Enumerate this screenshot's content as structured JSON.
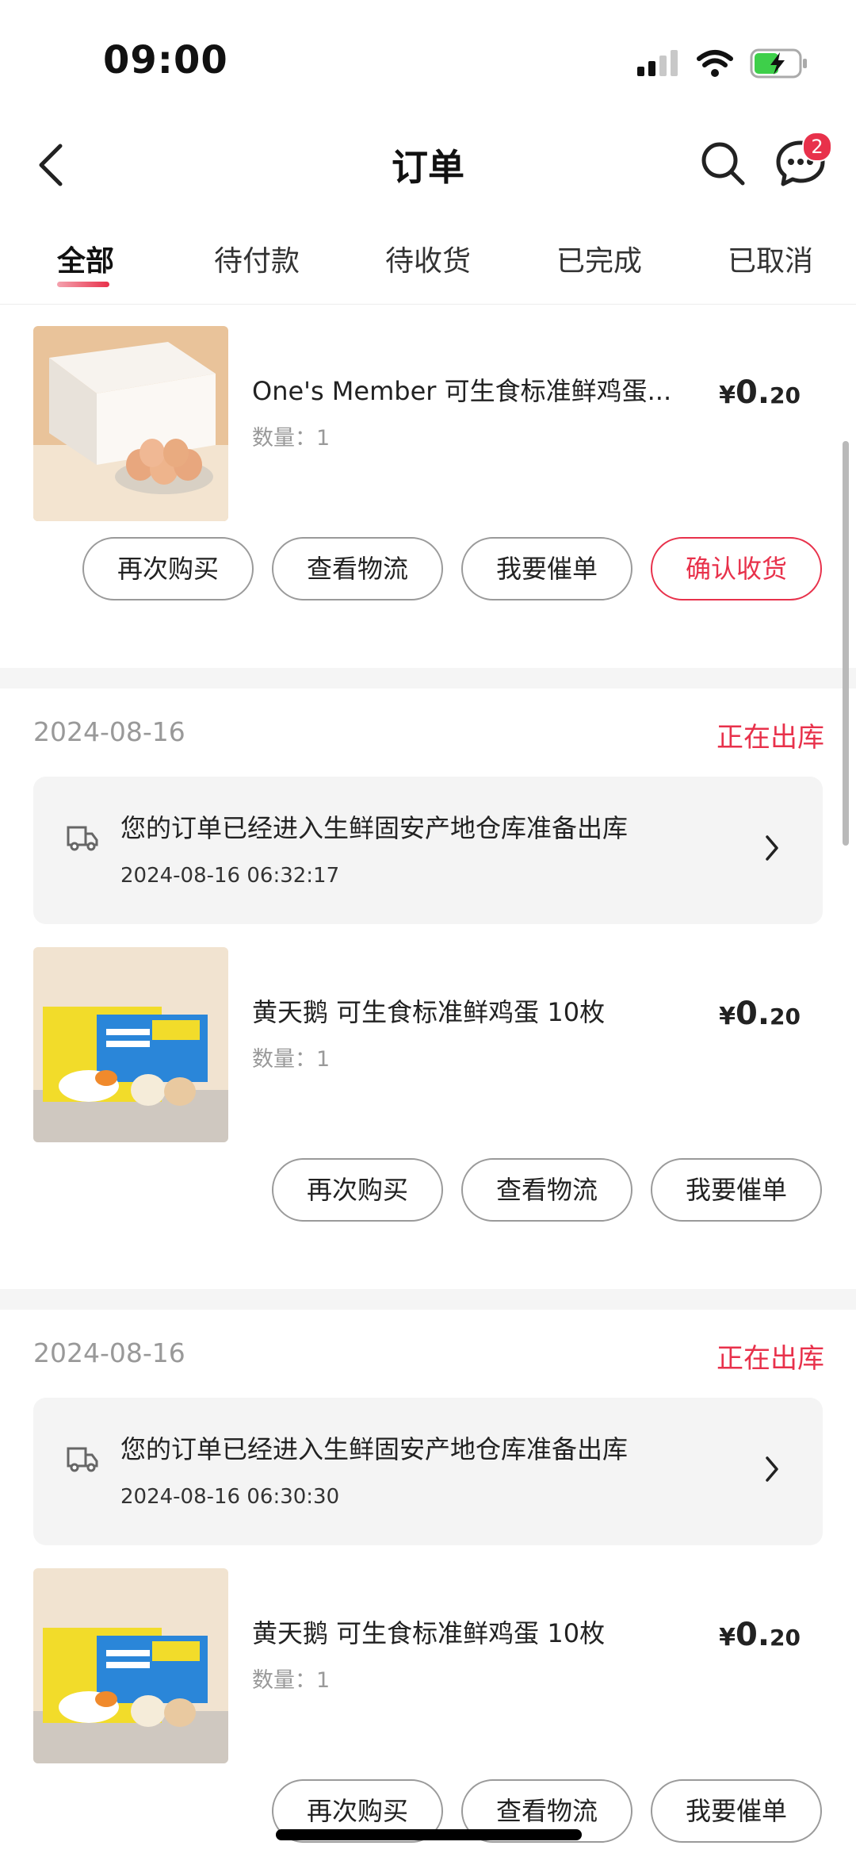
{
  "status_bar": {
    "time": "09:00"
  },
  "header": {
    "title": "订单",
    "message_badge": "2"
  },
  "tabs": [
    {
      "label": "全部",
      "active": true
    },
    {
      "label": "待付款",
      "active": false
    },
    {
      "label": "待收货",
      "active": false
    },
    {
      "label": "已完成",
      "active": false
    },
    {
      "label": "已取消",
      "active": false
    }
  ],
  "orders": [
    {
      "product": {
        "name": "One's Member 可生食标准鲜鸡蛋...",
        "quantity": "数量：1",
        "price_symbol": "¥",
        "price_int": "0.",
        "price_dec": "20"
      },
      "buttons": [
        "再次购买",
        "查看物流",
        "我要催单",
        "确认收货"
      ]
    },
    {
      "date": "2024-08-16",
      "status": "正在出库",
      "notice": {
        "text": "您的订单已经进入生鲜固安产地仓库准备出库",
        "time": "2024-08-16 06:32:17"
      },
      "product": {
        "name": "黄天鹅 可生食标准鲜鸡蛋 10枚",
        "quantity": "数量：1",
        "price_symbol": "¥",
        "price_int": "0.",
        "price_dec": "20"
      },
      "buttons": [
        "再次购买",
        "查看物流",
        "我要催单"
      ]
    },
    {
      "date": "2024-08-16",
      "status": "正在出库",
      "notice": {
        "text": "您的订单已经进入生鲜固安产地仓库准备出库",
        "time": "2024-08-16 06:30:30"
      },
      "product": {
        "name": "黄天鹅 可生食标准鲜鸡蛋 10枚",
        "quantity": "数量：1",
        "price_symbol": "¥",
        "price_int": "0.",
        "price_dec": "20"
      },
      "buttons": [
        "再次购买",
        "查看物流",
        "我要催单"
      ]
    }
  ],
  "colors": {
    "accent": "#e8314b",
    "muted": "#999999",
    "panel": "#f4f4f4"
  },
  "icons": [
    "back-arrow-icon",
    "search-icon",
    "chat-bubble-icon",
    "truck-icon",
    "chevron-right-icon"
  ]
}
